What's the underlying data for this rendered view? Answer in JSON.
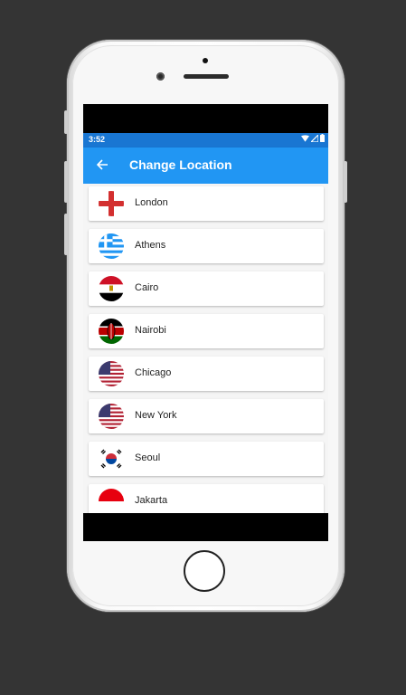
{
  "status_bar": {
    "time": "3:52",
    "icons": [
      "wifi-icon",
      "signal-icon",
      "battery-icon"
    ]
  },
  "app_bar": {
    "title": "Change Location",
    "back_icon": "arrow-left-icon",
    "color": "#2196f3"
  },
  "locations": [
    {
      "city": "London",
      "flag": "england-flag-icon"
    },
    {
      "city": "Athens",
      "flag": "greece-flag-icon"
    },
    {
      "city": "Cairo",
      "flag": "egypt-flag-icon"
    },
    {
      "city": "Nairobi",
      "flag": "kenya-flag-icon"
    },
    {
      "city": "Chicago",
      "flag": "usa-flag-icon"
    },
    {
      "city": "New York",
      "flag": "usa-flag-icon"
    },
    {
      "city": "Seoul",
      "flag": "south-korea-flag-icon"
    },
    {
      "city": "Jakarta",
      "flag": "indonesia-flag-icon"
    }
  ]
}
